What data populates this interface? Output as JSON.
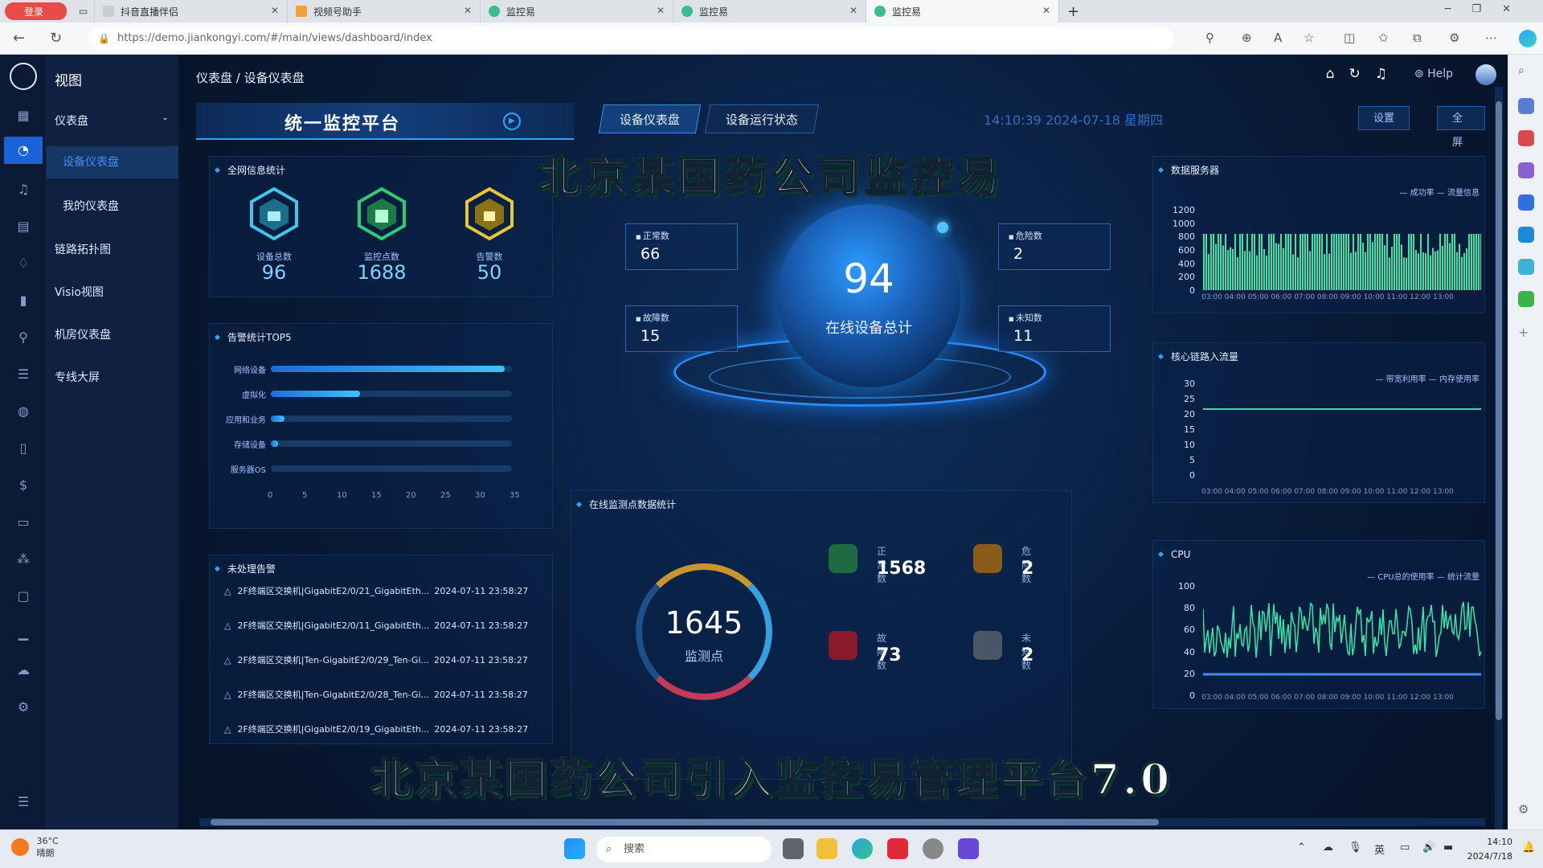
{
  "browser": {
    "tabs": [
      {
        "label": "登录",
        "fav": "#d33"
      },
      {
        "label": "抖音直播伴侣",
        "fav": "#999"
      },
      {
        "label": "视频号助手",
        "fav": "#f0a23a"
      },
      {
        "label": "监控易",
        "fav": "#3cbc8d"
      },
      {
        "label": "监控易",
        "fav": "#3cbc8d"
      },
      {
        "label": "监控易",
        "fav": "#3cbc8d"
      }
    ],
    "url": "https://demo.jiankongyi.com/#/main/views/dashboard/index",
    "new_tab": "+"
  },
  "sidebar": {
    "title": "视图",
    "items": [
      {
        "label": "仪表盘",
        "expand": "-"
      },
      {
        "label": "设备仪表盘"
      },
      {
        "label": "我的仪表盘"
      },
      {
        "label": "链路拓扑图"
      },
      {
        "label": "Visio视图"
      },
      {
        "label": "机房仪表盘"
      },
      {
        "label": "专线大屏"
      }
    ]
  },
  "header": {
    "breadcrumb": "仪表盘  /  设备仪表盘",
    "help": "Help"
  },
  "dashboard": {
    "platform_title": "统一监控平台",
    "tabs": [
      "设备仪表盘",
      "设备运行状态"
    ],
    "datetime": "14:10:39 2024-07-18 星期四",
    "buttons": [
      "设置",
      "全屏"
    ],
    "overall_stats": {
      "title": "全网信息统计",
      "items": [
        {
          "label": "设备总数",
          "value": "96",
          "color": "#41c7e8"
        },
        {
          "label": "监控点数",
          "value": "1688",
          "color": "#2ecc71"
        },
        {
          "label": "告警数",
          "value": "50",
          "color": "#e8c53a"
        }
      ]
    },
    "alarm_top5": {
      "title": "告警统计TOP5",
      "bars": [
        {
          "label": "网络设备",
          "value": 34
        },
        {
          "label": "虚拟化",
          "value": 13
        },
        {
          "label": "应用和业务",
          "value": 2
        },
        {
          "label": "存储设备",
          "value": 1
        },
        {
          "label": "服务器OS",
          "value": 0
        }
      ],
      "ticks": [
        "0",
        "5",
        "10",
        "15",
        "20",
        "25",
        "30",
        "35"
      ]
    },
    "unhandled_alarms": {
      "title": "未处理告警",
      "rows": [
        {
          "text": "2F终端区交换机|GigabitE2/0/21_GigabitEth...",
          "time": "2024-07-11 23:58:27"
        },
        {
          "text": "2F终端区交换机|GigabitE2/0/11_GigabitEth...",
          "time": "2024-07-11 23:58:27"
        },
        {
          "text": "2F终端区交换机|Ten-GigabitE2/0/29_Ten-Gi...",
          "time": "2024-07-11 23:58:27"
        },
        {
          "text": "2F终端区交换机|Ten-GigabitE2/0/28_Ten-Gi...",
          "time": "2024-07-11 23:58:27"
        },
        {
          "text": "2F终端区交换机|GigabitE2/0/19_GigabitEth...",
          "time": "2024-07-11 23:58:27"
        }
      ]
    },
    "online": {
      "total": "94",
      "total_label": "在线设备总计",
      "normal_label": "正常数",
      "normal": "66",
      "danger_label": "危险数",
      "danger": "2",
      "fault_label": "故障数",
      "fault": "15",
      "unknown_label": "未知数",
      "unknown": "11"
    },
    "monitor_points": {
      "title": "在线监测点数据统计",
      "total": "1645",
      "total_label": "监测点",
      "normal_label": "正常数",
      "normal": "1568",
      "danger_label": "危险数",
      "danger": "2",
      "fault_label": "故障数",
      "fault": "73",
      "unknown_label": "未知数",
      "unknown": "2"
    },
    "db_server": {
      "title": "数据服务器",
      "legend": "— 成功率  — 流量信息",
      "yticks": [
        "1200",
        "1000",
        "800",
        "600",
        "400",
        "200",
        "0"
      ],
      "xticks": "03:00 04:00 05:00 06:00 07:00 08:00 09:00 10:00 11:00 12:00 13:00"
    },
    "core_link": {
      "title": "核心链路入流量",
      "legend": "— 带宽利用率  — 内存使用率",
      "yticks": [
        "30",
        "25",
        "20",
        "15",
        "10",
        "5",
        "0"
      ],
      "xticks": "03:00 04:00 05:00 06:00 07:00 08:00 09:00 10:00 11:00 12:00 13:00"
    },
    "cpu": {
      "title": "CPU",
      "legend": "— CPU总的使用率  — 统计流量",
      "yticks": [
        "100",
        "80",
        "60",
        "40",
        "20",
        "0"
      ],
      "xticks": "03:00 04:00 05:00 06:00 07:00 08:00 09:00 10:00 11:00 12:00 13:00"
    }
  },
  "captions": {
    "top": "北京某国药公司监控易",
    "bottom": "北京某国药公司引入监控易管理平台7.0"
  },
  "taskbar": {
    "weather_temp": "36°C",
    "weather_desc": "晴朗",
    "search_placeholder": "搜索",
    "lang": "英",
    "time": "14:10",
    "date": "2024/7/18"
  }
}
